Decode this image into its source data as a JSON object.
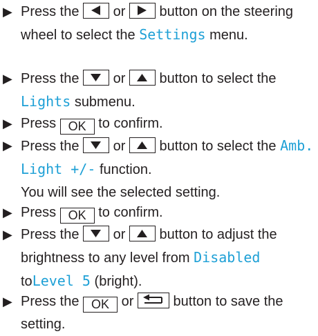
{
  "bullet": "▶",
  "colors": {
    "text": "#231f20",
    "display_text": "#1ea0d6"
  },
  "icons": {
    "left": "left-arrow-key-icon",
    "right": "right-arrow-key-icon",
    "down": "down-arrow-key-icon",
    "up": "up-arrow-key-icon",
    "back": "back-key-icon"
  },
  "steps": [
    {
      "t1": "Press the",
      "t2": "or",
      "t3": "button on the steering wheel to select the",
      "display": "Settings",
      "t4": "menu."
    },
    {
      "t1": "Press the",
      "t2": "or",
      "t3": "button to select the",
      "display": "Lights",
      "t4": "submenu."
    },
    {
      "t1": "Press",
      "key": "OK",
      "t2": "to confirm."
    },
    {
      "t1": "Press the",
      "t2": "or",
      "t3": "button to select the",
      "display": "Amb. Light +/-",
      "t4": "function.",
      "t5": "You will see the selected setting."
    },
    {
      "t1": "Press",
      "key": "OK",
      "t2": "to confirm."
    },
    {
      "t1": "Press the",
      "t2": "or",
      "t3": "button to adjust the brightness to any level from",
      "display1": "Disabled",
      "t4": "to",
      "display2": "Level 5",
      "t5": "(bright)."
    },
    {
      "t1": "Press the",
      "key": "OK",
      "t2": "or",
      "t3": "button to save the setting."
    }
  ]
}
